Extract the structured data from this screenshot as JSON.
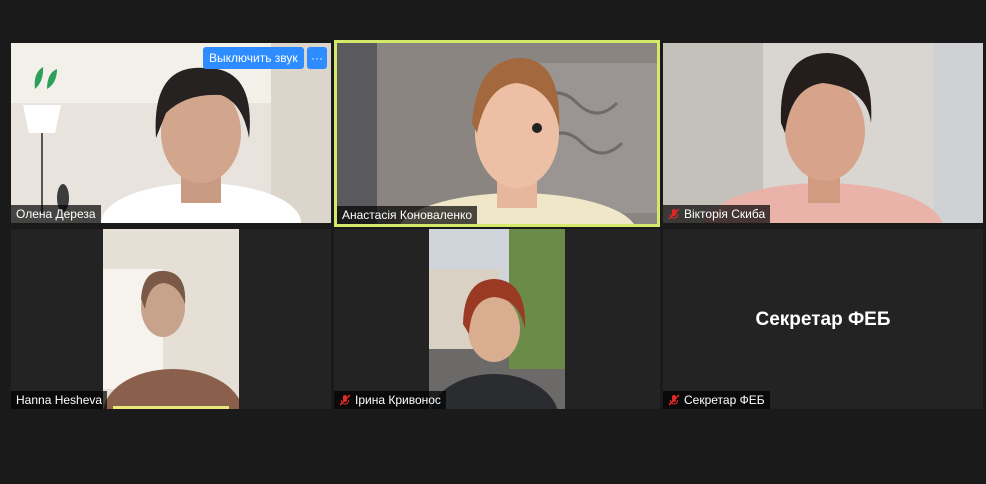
{
  "participants": [
    {
      "name": "Олена Дереза",
      "muted": false
    },
    {
      "name": "Анастасія Коноваленко",
      "muted": false,
      "speaking": true
    },
    {
      "name": "Вікторія Скиба",
      "muted": true
    },
    {
      "name": "Hanna Hesheva",
      "muted": false
    },
    {
      "name": "Ірина Кривонос",
      "muted": true
    },
    {
      "name": "Секретар ФЕБ",
      "muted": true,
      "video_off": true
    }
  ],
  "hover_controls": {
    "mute_label": "Выключить звук",
    "more_label": "···"
  },
  "colors": {
    "active_speaker_border": "#d4e86a",
    "button_blue": "#2d8cff",
    "mute_red": "#e02828"
  }
}
